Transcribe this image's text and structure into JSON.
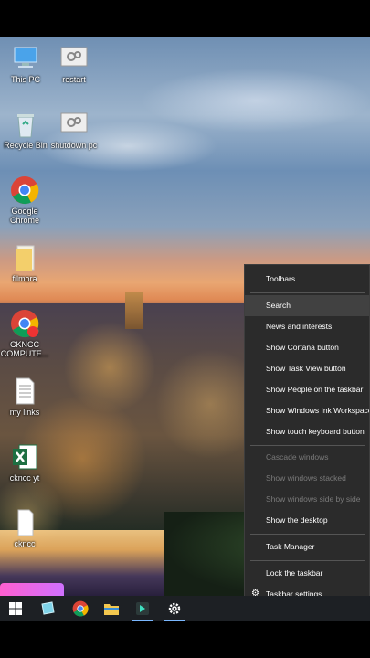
{
  "desktop_icons": [
    {
      "id": "this-pc",
      "label": "This PC"
    },
    {
      "id": "restart",
      "label": "restart"
    },
    {
      "id": "recycle-bin",
      "label": "Recycle Bin"
    },
    {
      "id": "shutdown-pc",
      "label": "shutdown pc"
    },
    {
      "id": "google-chrome",
      "label": "Google Chrome"
    },
    {
      "id": "filmora",
      "label": "filmora"
    },
    {
      "id": "ckncc",
      "label": "CKNCC COMPUTE..."
    },
    {
      "id": "my-links",
      "label": "my links"
    },
    {
      "id": "ckncc-yt",
      "label": "ckncc yt"
    },
    {
      "id": "ckncc2",
      "label": "ckncc"
    }
  ],
  "context_menu": {
    "items": [
      {
        "label": "Toolbars",
        "state": "normal"
      },
      {
        "label": "Search",
        "state": "highlighted"
      },
      {
        "label": "News and interests",
        "state": "normal"
      },
      {
        "label": "Show Cortana button",
        "state": "normal"
      },
      {
        "label": "Show Task View button",
        "state": "normal"
      },
      {
        "label": "Show People on the taskbar",
        "state": "normal"
      },
      {
        "label": "Show Windows Ink Workspace button",
        "state": "normal"
      },
      {
        "label": "Show touch keyboard button",
        "state": "normal"
      },
      {
        "label": "Cascade windows",
        "state": "disabled"
      },
      {
        "label": "Show windows stacked",
        "state": "disabled"
      },
      {
        "label": "Show windows side by side",
        "state": "disabled"
      },
      {
        "label": "Show the desktop",
        "state": "normal"
      },
      {
        "label": "Task Manager",
        "state": "normal"
      },
      {
        "label": "Lock the taskbar",
        "state": "normal"
      },
      {
        "label": "Taskbar settings",
        "state": "normal",
        "icon": "gear-icon"
      }
    ]
  },
  "taskbar": {
    "icons": [
      "windows-start-icon",
      "task-view-icon",
      "chrome-icon",
      "file-explorer-icon",
      "filmora-icon",
      "settings-icon"
    ],
    "active": [
      "filmora-icon",
      "settings-icon"
    ]
  },
  "colors": {
    "menu_bg": "#2b2b2b",
    "menu_highlight": "#414141",
    "menu_disabled": "#7a7a7a",
    "taskbar_bg": "#1d2024",
    "accent": "#7ab7ff"
  }
}
